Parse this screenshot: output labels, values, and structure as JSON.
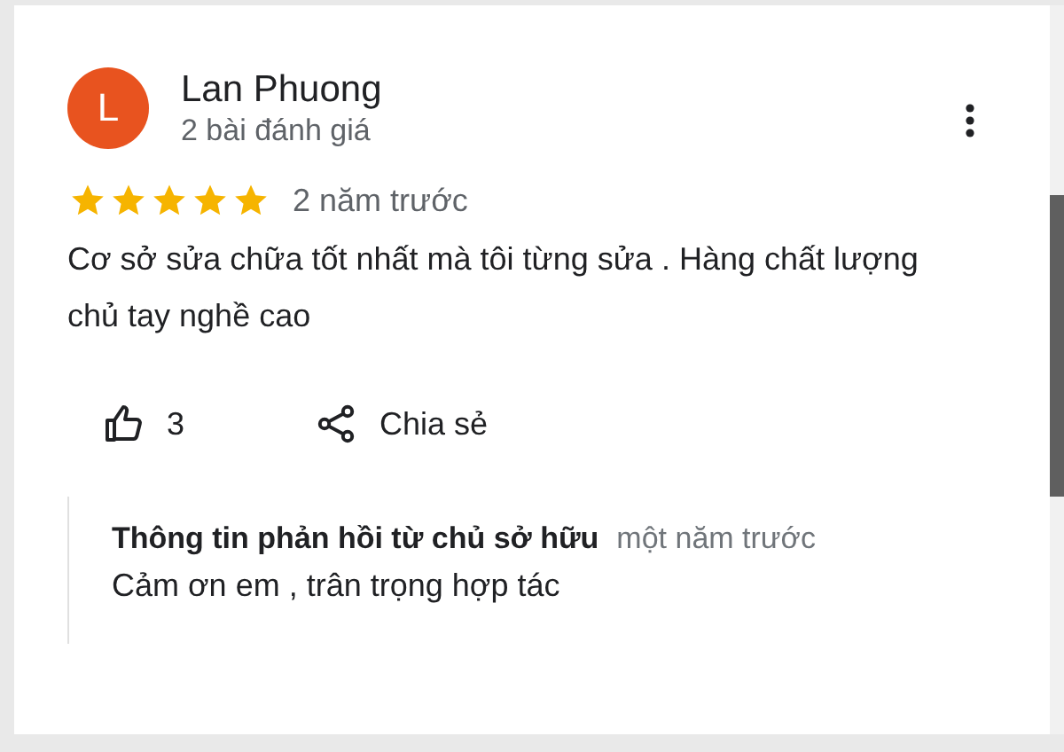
{
  "review": {
    "avatar_letter": "L",
    "author": "Lan Phuong",
    "author_meta": "2 bài đánh giá",
    "stars": 5,
    "time": "2 năm trước",
    "text": "Cơ sở sửa chữa tốt nhất mà tôi từng sửa . Hàng chất lượng chủ tay nghề cao",
    "likes": "3",
    "share_label": "Chia sẻ"
  },
  "owner_reply": {
    "title": "Thông tin phản hồi từ chủ sở hữu",
    "time": "một năm trước",
    "text": "Cảm ơn em , trân trọng hợp tác"
  }
}
